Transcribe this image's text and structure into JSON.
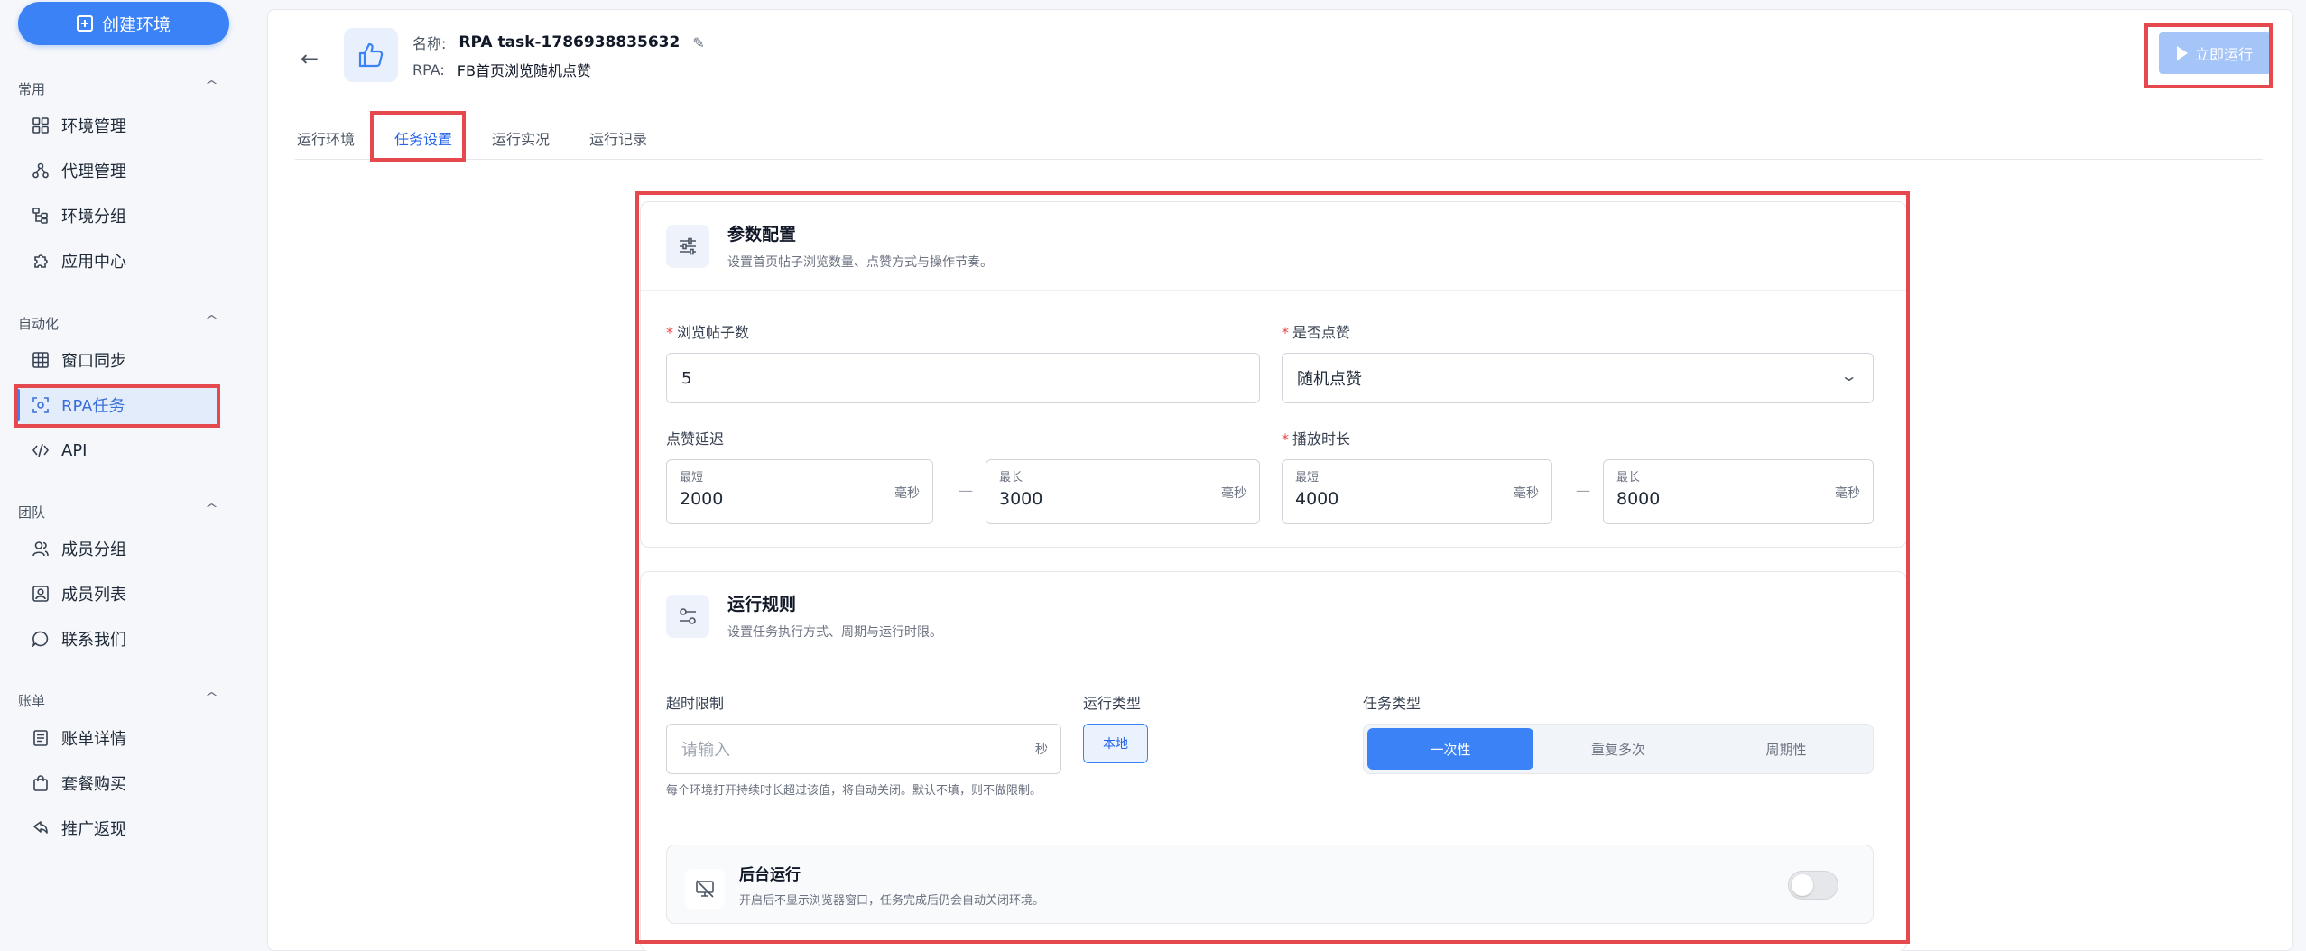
{
  "sidebar": {
    "create_label": "创建环境",
    "sections": {
      "common": "常用",
      "automation": "自动化",
      "team": "团队",
      "billing": "账单"
    },
    "items": {
      "env_manage": "环境管理",
      "proxy_manage": "代理管理",
      "env_group": "环境分组",
      "app_center": "应用中心",
      "window_sync": "窗口同步",
      "rpa_task": "RPA任务",
      "api": "API",
      "member_group": "成员分组",
      "member_list": "成员列表",
      "contact_us": "联系我们",
      "bill_detail": "账单详情",
      "plan_purchase": "套餐购买",
      "promo_rebate": "推广返现"
    }
  },
  "header": {
    "name_label": "名称:",
    "name_value": "RPA task-1786938835632",
    "rpa_label": "RPA:",
    "rpa_value": "FB首页浏览随机点赞",
    "run_now": "立即运行"
  },
  "tabs": [
    "运行环境",
    "任务设置",
    "运行实况",
    "运行记录"
  ],
  "params": {
    "title": "参数配置",
    "subtitle": "设置首页帖子浏览数量、点赞方式与操作节奏。",
    "post_count_label": "浏览帖子数",
    "post_count_value": "5",
    "like_label": "是否点赞",
    "like_value": "随机点赞",
    "like_delay_label": "点赞延迟",
    "play_duration_label": "播放时长",
    "min_caption": "最短",
    "max_caption": "最长",
    "unit_ms": "毫秒",
    "dash": "—",
    "like_delay_min": "2000",
    "like_delay_max": "3000",
    "play_min": "4000",
    "play_max": "8000"
  },
  "rules": {
    "title": "运行规则",
    "subtitle": "设置任务执行方式、周期与运行时限。",
    "timeout_label": "超时限制",
    "timeout_placeholder": "请输入",
    "timeout_unit": "秒",
    "timeout_help": "每个环境打开持续时长超过该值，将自动关闭。默认不填，则不做限制。",
    "run_type_label": "运行类型",
    "run_type_value": "本地",
    "task_type_label": "任务类型",
    "task_types": [
      "一次性",
      "重复多次",
      "周期性"
    ],
    "bg_title": "后台运行",
    "bg_desc": "开启后不显示浏览器窗口，任务完成后仍会自动关闭环境。"
  },
  "colors": {
    "accent": "#3b82f6",
    "highlight": "#e5484d"
  }
}
